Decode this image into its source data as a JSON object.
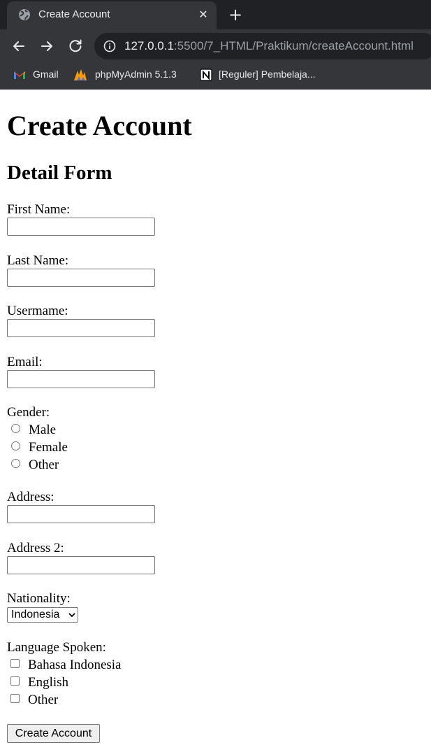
{
  "browser": {
    "tab": {
      "title": "Create Account",
      "icon": "globe-icon",
      "close_icon": "close-icon"
    },
    "new_tab_icon": "plus-icon",
    "nav": {
      "back_icon": "arrow-left-icon",
      "forward_icon": "arrow-right-icon",
      "reload_icon": "reload-icon"
    },
    "address": {
      "host": "127.0.0.1",
      "rest": ":5500/7_HTML/Praktikum/createAccount.html",
      "info_icon": "info-icon"
    },
    "bookmarks": [
      {
        "label": "Gmail",
        "icon": "gmail-icon"
      },
      {
        "label": "phpMyAdmin 5.1.3",
        "icon": "phpmyadmin-icon"
      },
      {
        "label": "[Reguler] Pembelaja...",
        "icon": "notion-icon"
      }
    ],
    "colors": {
      "tabbar": "#202124",
      "toolbar": "#35363a",
      "text": "#e8eaed",
      "muted": "#9aa0a6"
    }
  },
  "page": {
    "title": "Create Account",
    "subtitle": "Detail Form",
    "fields": {
      "first_name": {
        "label": "First Name:",
        "value": ""
      },
      "last_name": {
        "label": "Last Name:",
        "value": ""
      },
      "username": {
        "label": "Usermame:",
        "value": ""
      },
      "email": {
        "label": "Email:",
        "value": ""
      },
      "address": {
        "label": "Address:",
        "value": ""
      },
      "address2": {
        "label": "Address 2:",
        "value": ""
      }
    },
    "gender": {
      "label": "Gender:",
      "options": [
        "Male",
        "Female",
        "Other"
      ]
    },
    "nationality": {
      "label": "Nationality:",
      "selected": "Indonesia"
    },
    "languages": {
      "label": "Language Spoken:",
      "options": [
        "Bahasa Indonesia",
        "English",
        "Other"
      ]
    },
    "submit": "Create Account"
  }
}
